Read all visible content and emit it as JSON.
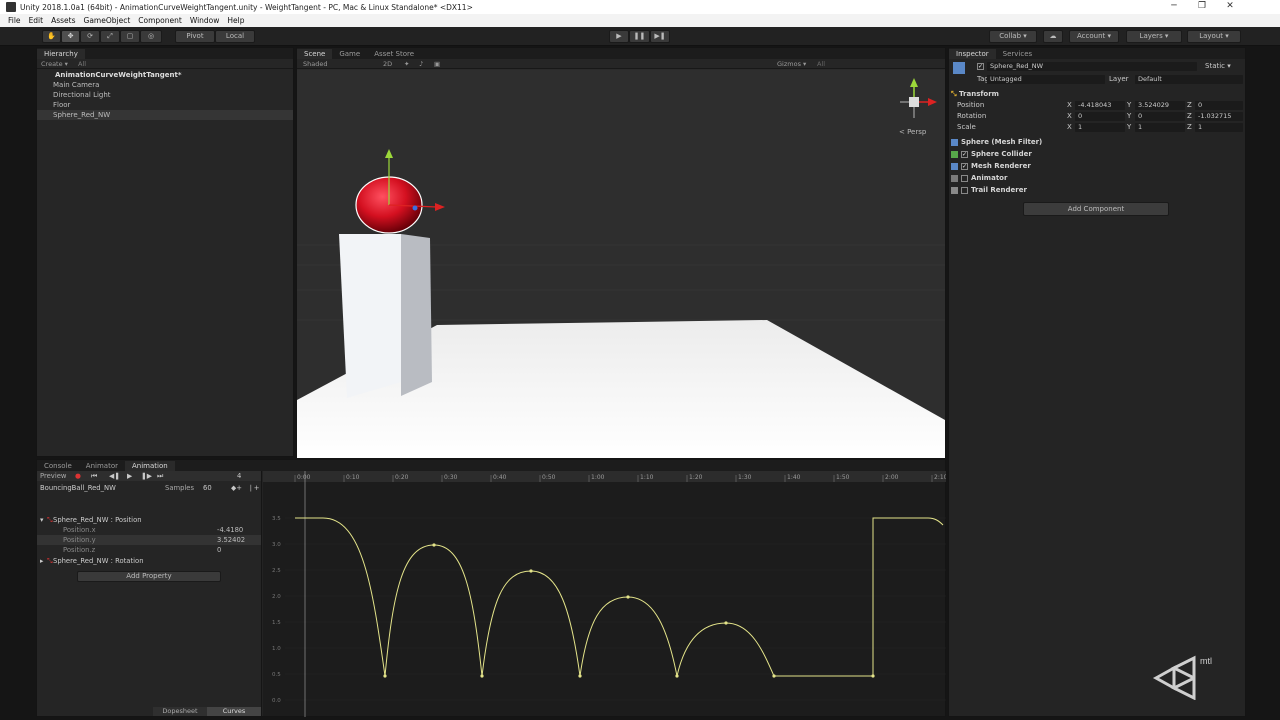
{
  "window": {
    "title": "Unity 2018.1.0a1 (64bit) - AnimationCurveWeightTangent.unity - WeightTangent - PC, Mac & Linux Standalone* <DX11>",
    "minimize": "─",
    "maximize": "❐",
    "close": "✕"
  },
  "menu": [
    "File",
    "Edit",
    "Assets",
    "GameObject",
    "Component",
    "Window",
    "Help"
  ],
  "toolbar": {
    "pivot": "Pivot",
    "local": "Local",
    "play": "▶",
    "pause": "❚❚",
    "step": "▶❚",
    "collab": "Collab ▾",
    "account": "Account ▾",
    "layers": "Layers ▾",
    "layout": "Layout ▾"
  },
  "hierarchy": {
    "tab": "Hierarchy",
    "create": "Create ▾",
    "search": "All",
    "scene": "AnimationCurveWeightTangent*",
    "items": [
      "Main Camera",
      "Directional Light",
      "Floor",
      "Sphere_Red_NW"
    ]
  },
  "scene": {
    "tabs": [
      "Scene",
      "Game",
      "Asset Store"
    ],
    "shading": "Shaded",
    "mode2d": "2D",
    "gizmos": "Gizmos ▾",
    "search": "All",
    "persp": "< Persp",
    "colors": {
      "sphere": "#d41020",
      "sky": "#2e2e2e",
      "floor": "#f4f4f4"
    }
  },
  "inspector": {
    "tabs": [
      "Inspector",
      "Services"
    ],
    "object_name": "Sphere_Red_NW",
    "static": "Static ▾",
    "tag_label": "Tag",
    "tag": "Untagged",
    "layer_label": "Layer",
    "layer": "Default",
    "transform": {
      "title": "Transform",
      "rows": [
        {
          "label": "Position",
          "x": "-4.418043",
          "y": "3.524029",
          "z": "0"
        },
        {
          "label": "Rotation",
          "x": "0",
          "y": "0",
          "z": "-1.032715"
        },
        {
          "label": "Scale",
          "x": "1",
          "y": "1",
          "z": "1"
        }
      ]
    },
    "components": [
      "Sphere (Mesh Filter)",
      "Sphere Collider",
      "Mesh Renderer",
      "Animator",
      "Trail Renderer"
    ],
    "add_component": "Add Component"
  },
  "bottom_tabs": [
    "Console",
    "Animator",
    "Animation"
  ],
  "animation": {
    "preview": "Preview",
    "frame": "4",
    "clip": "BouncingBall_Red_NW",
    "samples_label": "Samples",
    "samples": "60",
    "properties": [
      {
        "name": "Sphere_Red_NW : Position",
        "group": true
      },
      {
        "name": "Position.x",
        "value": "-4.4180"
      },
      {
        "name": "Position.y",
        "value": "3.52402"
      },
      {
        "name": "Position.z",
        "value": "0"
      },
      {
        "name": "Sphere_Red_NW : Rotation",
        "group": true
      }
    ],
    "add_property": "Add Property",
    "dopesheet": "Dopesheet",
    "curves": "Curves",
    "time_labels": [
      "0:00",
      "0:10",
      "0:20",
      "0:30",
      "0:40",
      "0:50",
      "1:00",
      "1:10",
      "1:20",
      "1:30",
      "1:40",
      "1:50",
      "2:00",
      "2:10"
    ],
    "value_labels": [
      "3.5",
      "3.0",
      "2.5",
      "2.0",
      "1.5",
      "1.0",
      "0.5",
      "0.0"
    ],
    "curve_color": "#e4e48a"
  },
  "watermark": "mtl"
}
